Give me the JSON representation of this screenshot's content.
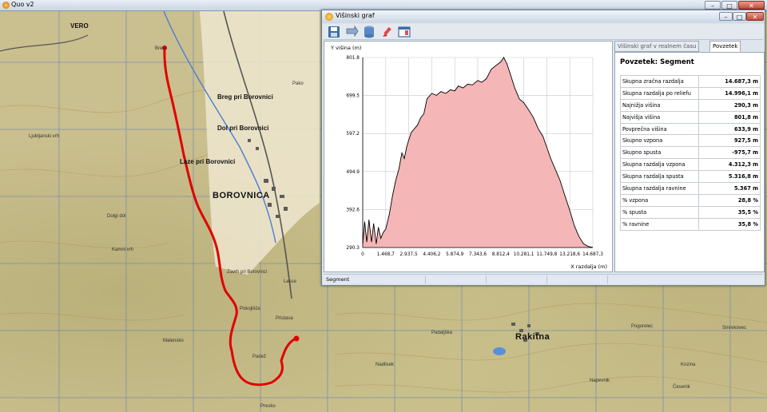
{
  "app": {
    "title": "Quo v2"
  },
  "window_controls": {
    "minimize": "–",
    "maximize": "□",
    "close": "✕"
  },
  "map": {
    "labels": [
      {
        "id": "vero",
        "text": "VERO",
        "size": "mid"
      },
      {
        "id": "brest",
        "text": "Brest",
        "size": "small"
      },
      {
        "id": "breg",
        "text": "Breg pri Borovnici",
        "size": "mid"
      },
      {
        "id": "dol",
        "text": "Dol pri Borovnici",
        "size": "mid"
      },
      {
        "id": "laze",
        "text": "Laze pri Borovnici",
        "size": "mid"
      },
      {
        "id": "borovnica",
        "text": "BOROVNICA",
        "size": "big"
      },
      {
        "id": "zavrh",
        "text": "Zavrh pri Borovnici",
        "size": "small"
      },
      {
        "id": "pokojisce",
        "text": "Pokojišče",
        "size": "small"
      },
      {
        "id": "pristava",
        "text": "Pristava",
        "size": "small"
      },
      {
        "id": "padez",
        "text": "Padež",
        "size": "small"
      },
      {
        "id": "rakitna",
        "text": "Rakitna",
        "size": "big"
      },
      {
        "id": "pako",
        "text": "Pako",
        "size": "small"
      },
      {
        "id": "lesce",
        "text": "Lesce",
        "size": "small"
      },
      {
        "id": "ljubljanski-vrh",
        "text": "Ljubljanski vrh",
        "size": "small"
      },
      {
        "id": "kamni-vrh",
        "text": "Kamni vrh",
        "size": "small"
      },
      {
        "id": "dolgi-dol",
        "text": "Dolgi dol",
        "size": "small"
      },
      {
        "id": "malenska",
        "text": "Malensko",
        "size": "small"
      },
      {
        "id": "padaljska",
        "text": "Padaljška",
        "size": "small"
      },
      {
        "id": "smrekovec",
        "text": "Smrekovec",
        "size": "small"
      },
      {
        "id": "pogorelec",
        "text": "Pogorelec",
        "size": "small"
      },
      {
        "id": "kozina",
        "text": "Kozina",
        "size": "small"
      },
      {
        "id": "napevnik",
        "text": "Napevnik",
        "size": "small"
      },
      {
        "id": "nadlisek",
        "text": "Nadlisek",
        "size": "small"
      },
      {
        "id": "cesenik",
        "text": "Česenik",
        "size": "small"
      },
      {
        "id": "presko",
        "text": "Presko",
        "size": "small"
      }
    ]
  },
  "graph_window": {
    "title": "Višinski graf",
    "toolbar": [
      {
        "id": "save",
        "icon": "save-icon"
      },
      {
        "id": "export",
        "icon": "export-icon"
      },
      {
        "id": "database",
        "icon": "database-icon"
      },
      {
        "id": "brush",
        "icon": "brush-icon"
      },
      {
        "id": "window",
        "icon": "window-icon"
      }
    ],
    "tabs": [
      {
        "label": "Višinski graf v realnem času",
        "active": false
      },
      {
        "label": "Povzetek",
        "active": true
      }
    ],
    "summary": {
      "heading": "Povzetek: Segment",
      "rows": [
        {
          "label": "Skupna zračna razdalja",
          "value": "14.687,3 m"
        },
        {
          "label": "Skupna razdalja po reliefu",
          "value": "14.996,1 m"
        },
        {
          "label": "Najnižja višina",
          "value": "290,3 m"
        },
        {
          "label": "Najvišja višina",
          "value": "801,8 m"
        },
        {
          "label": "Povprečna višina",
          "value": "633,9 m"
        },
        {
          "label": "Skupno vzpona",
          "value": "927,5 m"
        },
        {
          "label": "Skupno spusta",
          "value": "-975,7 m"
        },
        {
          "label": "Skupna razdalja vzpona",
          "value": "4.312,3 m"
        },
        {
          "label": "Skupna razdalja spusta",
          "value": "5.316,8 m"
        },
        {
          "label": "Skupna razdalja ravnine",
          "value": "5.367 m"
        },
        {
          "label": "% vzpona",
          "value": "28,8 %"
        },
        {
          "label": "% spusta",
          "value": "35,5 %"
        },
        {
          "label": "% ravnine",
          "value": "35,8 %"
        }
      ]
    },
    "status": {
      "segment": "Segment",
      "cell2": "",
      "cell3": "",
      "cell4": ""
    }
  },
  "chart_data": {
    "type": "area",
    "ylabel": "Y višina (m)",
    "xlabel": "X razdalja (m)",
    "ylim": [
      290.3,
      801.8
    ],
    "xlim": [
      0,
      14687.3
    ],
    "yticks": [
      "290.3",
      "392.6",
      "494.9",
      "597.2",
      "699.5",
      "801.8"
    ],
    "xticks": [
      "0",
      "1.468,7",
      "2.937,5",
      "4.406,2",
      "5.874,9",
      "7.343,6",
      "8.812,4",
      "10.281,1",
      "11.749,8",
      "13.218,6",
      "14.687,3"
    ],
    "grid": true,
    "fill_color": "#f4b6b6",
    "line_color": "#000000",
    "x": [
      0,
      120,
      260,
      400,
      560,
      700,
      860,
      1000,
      1150,
      1300,
      1468.7,
      1700,
      1900,
      2100,
      2300,
      2500,
      2650,
      2800,
      2937.5,
      3100,
      3300,
      3500,
      3700,
      3900,
      4100,
      4406.2,
      4700,
      5000,
      5300,
      5600,
      5874.9,
      6100,
      6400,
      6700,
      7000,
      7343.6,
      7600,
      7900,
      8200,
      8500,
      8812.4,
      9000,
      9200,
      9400,
      9700,
      10000,
      10281.1,
      10600,
      10900,
      11200,
      11500,
      11749.8,
      12000,
      12300,
      12600,
      12900,
      13218.6,
      13500,
      13800,
      14100,
      14400,
      14687.3
    ],
    "y": [
      300,
      360,
      305,
      365,
      305,
      355,
      300,
      345,
      315,
      330,
      340,
      380,
      430,
      470,
      500,
      545,
      530,
      560,
      580,
      600,
      610,
      620,
      640,
      650,
      690,
      705,
      700,
      710,
      705,
      715,
      712,
      725,
      720,
      730,
      728,
      740,
      735,
      745,
      770,
      780,
      790,
      802,
      785,
      760,
      720,
      690,
      680,
      660,
      640,
      610,
      590,
      560,
      530,
      500,
      470,
      430,
      390,
      350,
      320,
      300,
      293,
      290.3
    ]
  },
  "colors": {
    "track": "#e00000",
    "accent": "#3a6ea5"
  }
}
